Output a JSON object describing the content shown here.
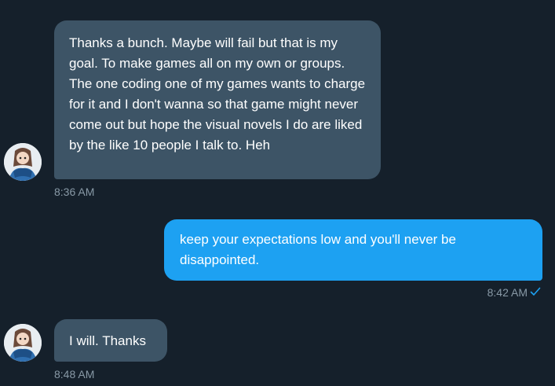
{
  "conversation": {
    "messages": [
      {
        "direction": "incoming",
        "text": "Thanks a bunch. Maybe will fail but that is my goal. To make games all on my own or groups. The one coding one of my games wants to charge for it and I don't wanna so that game might never come out but hope the visual novels I do are liked by the like 10 people I talk to. Heh",
        "time": "8:36 AM",
        "avatar_icon": "user-avatar"
      },
      {
        "direction": "outgoing",
        "text": "keep your expectations low and you'll never be disappointed.",
        "time": "8:42 AM",
        "status_icon": "check-icon"
      },
      {
        "direction": "incoming",
        "text": "I will. Thanks",
        "time": "8:48 AM",
        "avatar_icon": "user-avatar"
      }
    ]
  },
  "theme": {
    "background": "#15202b",
    "incoming_bubble": "#3d5466",
    "outgoing_bubble": "#1da1f2",
    "timestamp_color": "#8899a6",
    "check_color": "#1da1f2"
  }
}
